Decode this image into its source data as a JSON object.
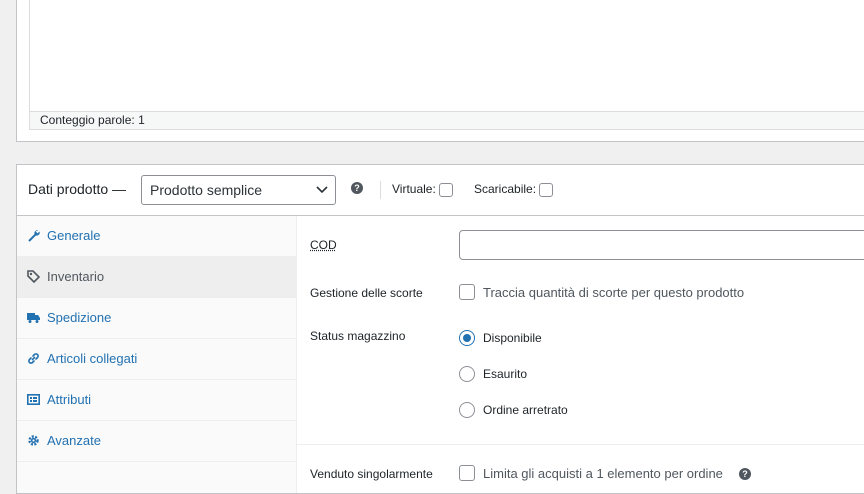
{
  "editor": {
    "word_count": "Conteggio parole: 1"
  },
  "product_data": {
    "title": "Dati prodotto —",
    "type_select_value": "Prodotto semplice",
    "virtual_label": "Virtuale:",
    "downloadable_label": "Scaricabile:"
  },
  "tabs": [
    {
      "label": "Generale",
      "icon": "wrench-icon"
    },
    {
      "label": "Inventario",
      "icon": "tag-icon"
    },
    {
      "label": "Spedizione",
      "icon": "truck-icon"
    },
    {
      "label": "Articoli collegati",
      "icon": "link-icon"
    },
    {
      "label": "Attributi",
      "icon": "list-icon"
    },
    {
      "label": "Avanzate",
      "icon": "gear-icon"
    }
  ],
  "inventory": {
    "sku_label": "COD",
    "sku_value": "",
    "stock_mgmt_label": "Gestione delle scorte",
    "stock_mgmt_option": "Traccia quantità di scorte per questo prodotto",
    "stock_status_label": "Status magazzino",
    "stock_status_options": [
      "Disponibile",
      "Esaurito",
      "Ordine arretrato"
    ],
    "stock_status_selected": "Disponibile",
    "sold_individually_label": "Venduto singolarmente",
    "sold_individually_option": "Limita gli acquisti a 1 elemento per ordine"
  },
  "colors": {
    "accent": "#2271b1",
    "background": "#f0f0f1",
    "border": "#c3c4c7"
  }
}
